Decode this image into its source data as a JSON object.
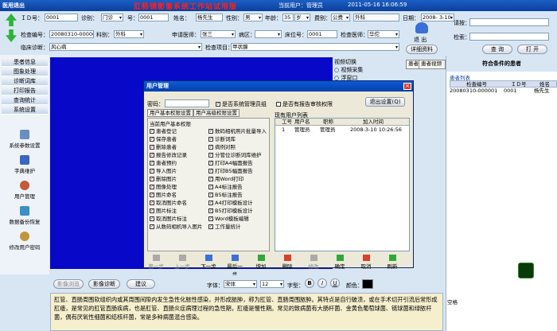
{
  "titlebar": {
    "exit": "医用退出",
    "app_title": "肛肠镜影像系统工作站试用版",
    "current_user": "当前用户：管理员",
    "datetime": "2011-05-16 16:06:59"
  },
  "form": {
    "id_label": "ＩＤ号：",
    "id_value": "0001",
    "zhenbie_label": "诊别：",
    "zhenbie_value": "门诊",
    "hao_label": "号：",
    "hao_value": "0001",
    "name_label": "姓名：",
    "name_value": "杨先生",
    "sex_label": "性别：",
    "sex_value": "男",
    "age_label": "年龄：",
    "age_value": "35",
    "age_unit": "岁",
    "fee_label": "费别：",
    "fee_value": "公费",
    "dept_value": "外科",
    "date_label": "日期：",
    "date_value": "2008- 3-10",
    "check_no_label": "检查编号：",
    "check_no_value": "20080310-000001",
    "dept_label": "科别：",
    "doctor_req_label": "申请医师：",
    "doctor_req_value": "张三",
    "ward_label": "病区：",
    "bed_label": "床位号：",
    "bed_value": "0001",
    "check_doc_label": "检查医师：",
    "check_doc_value": "华佗",
    "clinic_label": "临床诊断：",
    "clinic_value": "风心病",
    "project_label": "检查项目：",
    "project_value": "甲状腺"
  },
  "toolbar": {
    "exit_label": "退 出",
    "detail_label": "详细资料",
    "req_label": "请按：",
    "search_label": "检索：",
    "query_label": "查 询",
    "open_label": "打 开"
  },
  "sidebar": {
    "items": [
      "患者信息",
      "图象处理",
      "诊断词库",
      "打印报告",
      "查询统计",
      "系统设置"
    ],
    "tools": [
      "系统参数设置",
      "字典维护",
      "用户管理",
      "数据备份恢复",
      "修改用户密码"
    ]
  },
  "video": {
    "title": "视频切换",
    "opt1": "视频采集",
    "opt2": "浮窗口",
    "tab1": "患者图片",
    "tab2": "患者视频"
  },
  "rightpanel": {
    "title": "符合条件的患者",
    "list_label": "患者列表",
    "headers": [
      "检查编号",
      "ＩＤ号",
      "姓名"
    ],
    "row": [
      "20080310-000001",
      "0001",
      "杨先生"
    ]
  },
  "dialog": {
    "title": "用户管理",
    "password_label": "密码：",
    "is_admin": "是否系统管理员组",
    "has_audit": "是否有报告审核权限",
    "exit_btn": "退出设置(Q)",
    "tab1": "用户基本权限设置",
    "tab2": "用户高级权限设置",
    "perm_group": "当前用户基本权限",
    "perms_left": [
      "患者登记",
      "保存患者",
      "删除患者",
      "报告修改记录",
      "患者预约",
      "导入图片",
      "删除图片",
      "图像处理",
      "图片命名",
      "取消图片命名",
      "图片标注",
      "取消图片标注",
      "从数码相机导入图片"
    ],
    "perms_right": [
      "数码相机照片批量导入",
      "诊断词库",
      "病例对照",
      "分管位诊断词库维护",
      "打印A4幅面报告",
      "打印B5幅面报告",
      "用Word打印",
      "A4标注报告",
      "B5标注报告",
      "A4打印模板设计",
      "B5打印模板设计",
      "Word模板编辑",
      "工作量统计"
    ],
    "list_title": "现有用户列表",
    "user_headers": [
      "工号",
      "用户名",
      "职称",
      "加入时间"
    ],
    "user_row": [
      "1",
      "管理员",
      "管理员",
      "2008-3-10 10:26:56"
    ],
    "nav": [
      "第一步",
      "上一步",
      "下一步",
      "最后一步",
      "增加",
      "删除",
      "修改",
      "确定",
      "取消",
      "刷新"
    ]
  },
  "bottombar": {
    "btn1": "影像浏览",
    "btn2": "影像诊断",
    "btn3": "建议",
    "font_label": "字体：",
    "font_value": "宋体",
    "size_value": "12",
    "style_label": "字型：",
    "bold": "B",
    "italic": "I",
    "underline": "U",
    "color_label": "颜色：",
    "space_label": "空格"
  },
  "report_text": "肛管、直肠周围软组织内或其周围间隙内发生急性化脓性感染，并形成脓肿，称为肛管、直肠周围脓肿。其特点是自行破溃，或在手术切开引流后常形成肛瘘，是常见的肛管直肠疾病，也是肛管、直肠炎症病理过程的急性期，肛瘘是慢性期。常见的致病菌有大肠杆菌、金黄色葡萄球菌、链球菌和绿脓杆菌，偶有厌氧性细菌和结核杆菌，常是多种病菌混合感染。",
  "colors": {
    "accent": "#0b3f9e",
    "canvas": "#0808c8",
    "title_red": "#ff2020"
  }
}
